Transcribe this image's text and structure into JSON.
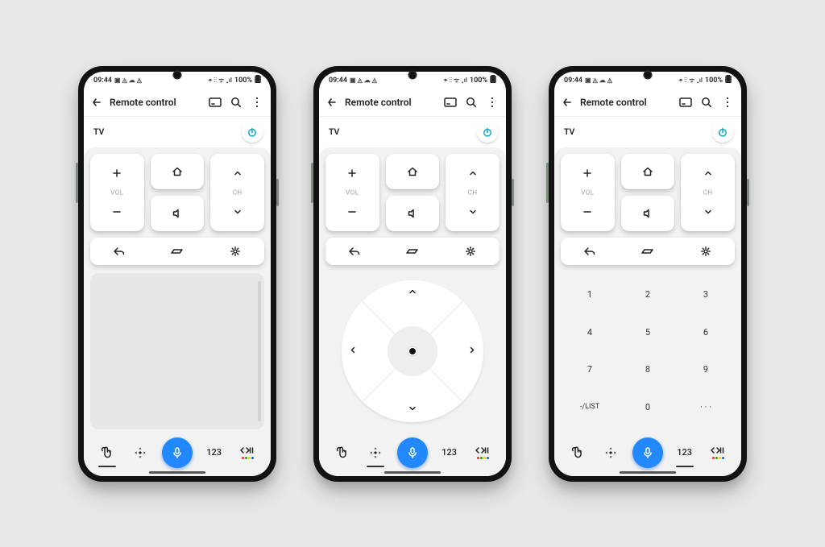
{
  "status": {
    "time": "09:44",
    "left_indicators": "▣ ◬ ☁ ◬",
    "right_indicators": "⌖ ⋮⋮ ᯤ ₊ıl",
    "battery": "100%"
  },
  "header": {
    "title": "Remote control"
  },
  "device": {
    "name": "TV"
  },
  "rockers": {
    "vol_label": "VOL",
    "ch_label": "CH"
  },
  "navtabs": {
    "num_label": "123"
  },
  "numpad": {
    "keys": [
      "1",
      "2",
      "3",
      "4",
      "5",
      "6",
      "7",
      "8",
      "9",
      "-/LIST",
      "0",
      "· · ·"
    ]
  },
  "colors": {
    "accent": "#2288ff",
    "power": "#14a8c8"
  },
  "media_dots": [
    "#e33",
    "#2a2",
    "#ec2",
    "#26c"
  ]
}
